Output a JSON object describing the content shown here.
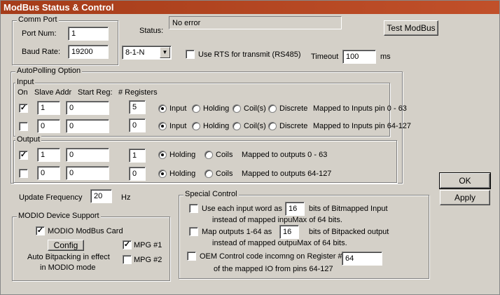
{
  "window": {
    "title": "ModBus Status & Control"
  },
  "comm_port": {
    "group_label": "Comm Port",
    "port_label": "Port Num:",
    "port_value": "1",
    "baud_label": "Baud Rate:",
    "baud_value": "19200",
    "format_value": "8-1-N"
  },
  "status": {
    "label": "Status:",
    "value": "No error"
  },
  "test_button": "Test ModBus",
  "rts": {
    "label": "Use RTS for transmit (RS485)",
    "checked": false
  },
  "timeout": {
    "label": "Timeout",
    "value": "100",
    "unit": "ms"
  },
  "autopolling": {
    "group_label": "AutoPolling Option"
  },
  "input": {
    "group_label": "Input",
    "headers": {
      "on": "On",
      "slave": "Slave Addr",
      "start": "Start Reg:",
      "count": "# Registers"
    },
    "rows": [
      {
        "checked": true,
        "slave": "1",
        "start": "0",
        "count": "5",
        "selected": "Input",
        "mapping": "Mapped to Inputs pin 0 - 63"
      },
      {
        "checked": false,
        "slave": "0",
        "start": "0",
        "count": "0",
        "selected": "Input",
        "mapping": "Mapped to Inputs pin 64-127"
      }
    ],
    "types": [
      "Input",
      "Holding",
      "Coil(s)",
      "Discrete"
    ]
  },
  "output": {
    "group_label": "Output",
    "rows": [
      {
        "checked": true,
        "slave": "1",
        "start": "0",
        "count": "1",
        "selected": "Holding",
        "mapping": "Mapped to outputs 0 - 63"
      },
      {
        "checked": false,
        "slave": "0",
        "start": "0",
        "count": "0",
        "selected": "Holding",
        "mapping": "Mapped to outputs 64-127"
      }
    ],
    "types": [
      "Holding",
      "Coils"
    ]
  },
  "ok_button": "OK",
  "apply_button": "Apply",
  "update": {
    "label": "Update Frequency",
    "value": "20",
    "unit": "Hz"
  },
  "modio": {
    "group_label": "MODIO Device Support",
    "card_label": "MODIO ModBus Card",
    "card_checked": true,
    "config_button": "Config",
    "mpg1_label": "MPG #1",
    "mpg1_checked": true,
    "mpg2_label": "MPG #2",
    "mpg2_checked": false,
    "note_line1": "Auto Bitpacking in effect",
    "note_line2": "in MODIO mode"
  },
  "special": {
    "group_label": "Special Control",
    "opt1": {
      "checked": false,
      "prefix": "Use each input word as",
      "value": "16",
      "suffix": "bits of Bitmapped Input",
      "line2": "instead of mapped inpuMax of 64 bits."
    },
    "opt2": {
      "checked": false,
      "prefix": "Map outputs 1-64 as",
      "value": "16",
      "suffix": "bits of Bitpacked output",
      "line2": "instead of mapped outpuMax of 64 bits."
    },
    "opt3": {
      "checked": false,
      "prefix": "OEM Control code incomng on Register #",
      "value": "64",
      "line2": "of the mapped IO from pins 64-127"
    }
  }
}
